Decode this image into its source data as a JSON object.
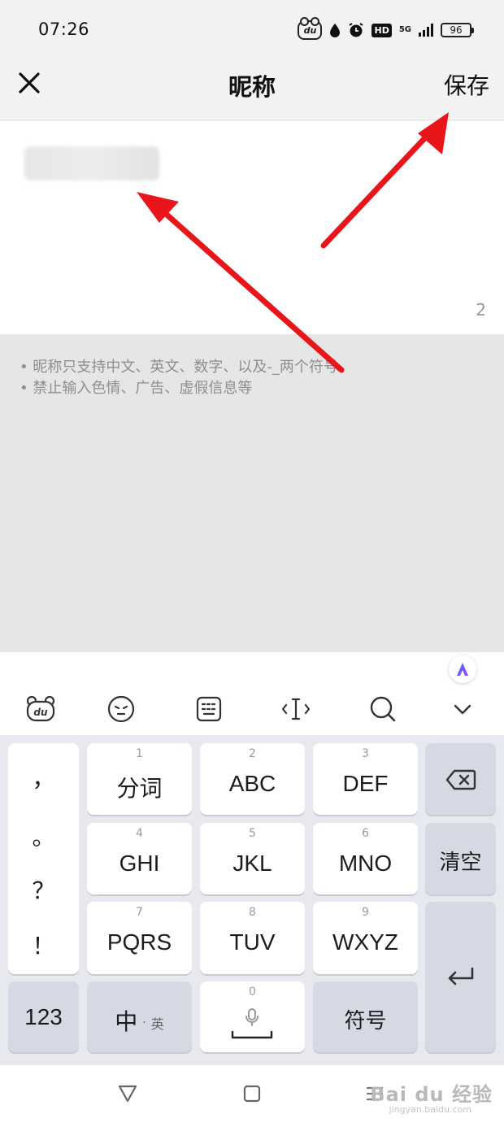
{
  "status_bar": {
    "time": "07:26",
    "du_label": "du",
    "hd_label": "HD",
    "network_label": "5G",
    "battery_level": "96"
  },
  "header": {
    "title": "昵称",
    "save_label": "保存",
    "close_icon": "close-icon"
  },
  "nickname_input": {
    "char_count": "2",
    "value_blurred": true
  },
  "hints": [
    "• 昵称只支持中文、英文、数字、以及-_两个符号",
    "• 禁止输入色情、广告、虚假信息等"
  ],
  "keyboard": {
    "toolbar_icons": [
      "du-keyboard-icon",
      "emoji-icon",
      "keyboard-layout-icon",
      "cursor-move-icon",
      "search-icon",
      "collapse-chevron-icon"
    ],
    "punctuation": [
      "，",
      "。",
      "？",
      "！"
    ],
    "keys": [
      {
        "num": "1",
        "label": "分词"
      },
      {
        "num": "2",
        "label": "ABC"
      },
      {
        "num": "3",
        "label": "DEF"
      },
      {
        "num": "4",
        "label": "GHI"
      },
      {
        "num": "5",
        "label": "JKL"
      },
      {
        "num": "6",
        "label": "MNO"
      },
      {
        "num": "7",
        "label": "PQRS"
      },
      {
        "num": "8",
        "label": "TUV"
      },
      {
        "num": "9",
        "label": "WXYZ"
      }
    ],
    "clear_label": "清空",
    "numeric_label": "123",
    "lang_main": "中",
    "lang_dot": "·",
    "lang_alt": "英",
    "space_num": "0",
    "symbol_label": "符号"
  },
  "watermark": {
    "text": "Bai du 经验",
    "sub": "jingyan.baidu.com"
  },
  "colors": {
    "arrow": "#e8161b",
    "ai_badge": "#4b5cf0"
  }
}
